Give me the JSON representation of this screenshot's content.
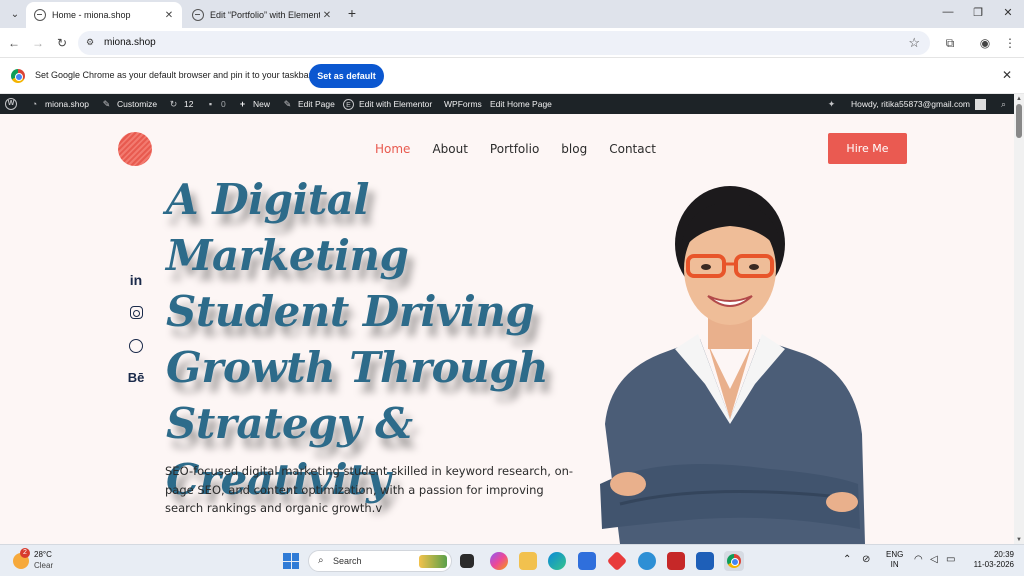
{
  "browser": {
    "tabs": [
      {
        "title": "Home - miona.shop",
        "active": true
      },
      {
        "title": "Edit “Portfolio” with Elementor",
        "active": false
      }
    ],
    "url": "miona.shop",
    "infobar": {
      "text": "Set Google Chrome as your default browser and pin it to your taskbar",
      "button": "Set as default"
    }
  },
  "adminbar": {
    "site": "miona.shop",
    "customize": "Customize",
    "updates": "12",
    "comments": "0",
    "new": "New",
    "edit_page": "Edit Page",
    "elementor": "Edit with Elementor",
    "wpforms": "WPForms",
    "edit_home": "Edit Home Page",
    "howdy": "Howdy, ritika55873@gmail.com"
  },
  "site": {
    "nav": [
      {
        "label": "Home",
        "active": true
      },
      {
        "label": "About",
        "active": false
      },
      {
        "label": "Portfolio",
        "active": false
      },
      {
        "label": "blog",
        "active": false
      },
      {
        "label": "Contact",
        "active": false
      }
    ],
    "hire_button": "Hire Me",
    "social": {
      "linkedin": "in",
      "behance": "Bē"
    },
    "hero": {
      "title_lines": [
        "A Digital Marketing",
        "Student Driving",
        "Growth Through",
        "Strategy &",
        "Creativity"
      ],
      "description": "SEO-focused digital marketing student skilled in keyword research, on-page SEO, and content optimization, with a passion for improving search rankings and organic growth.v"
    },
    "colors": {
      "accent": "#e85a4f",
      "title": "#2d6b8a",
      "background": "#fdf6f5"
    }
  },
  "taskbar": {
    "weather": {
      "badge": "2",
      "temp": "28°C",
      "condition": "Clear"
    },
    "search_placeholder": "Search",
    "language": {
      "line1": "ENG",
      "line2": "IN"
    },
    "clock": {
      "time": "20:39",
      "date": "11-03-2026"
    }
  }
}
